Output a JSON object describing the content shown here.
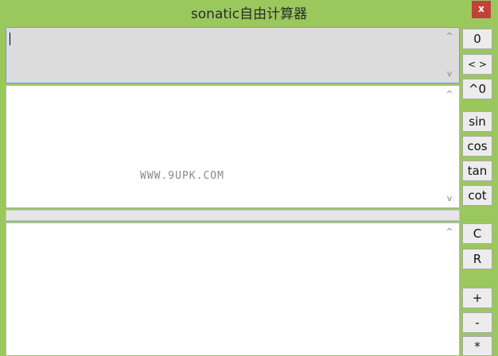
{
  "window": {
    "title": "sonatic自由计算器",
    "close_label": "x"
  },
  "input": {
    "value": ""
  },
  "output": {
    "watermark": "WWW.9UPK.COM"
  },
  "scroll": {
    "up": "^",
    "down": "v"
  },
  "side_buttons": {
    "zero": "0",
    "swap": "< >",
    "pow0": "^0",
    "sin": "sin",
    "cos": "cos",
    "tan": "tan",
    "cot": "cot",
    "clear": "C",
    "recall": "R",
    "plus": "+",
    "minus": "-",
    "multiply": "*"
  },
  "colors": {
    "window_frame": "#9bc85c",
    "close_button": "#c4413b",
    "input_border": "#6aa0d8"
  }
}
